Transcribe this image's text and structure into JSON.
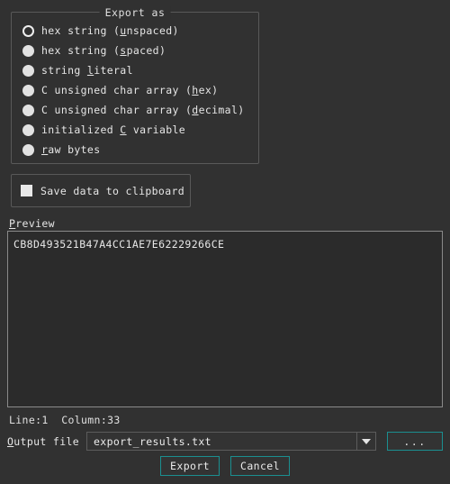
{
  "dialog": {
    "background_color": "#313131",
    "accent_color": "#1b8f90",
    "text_color": "#e8e8e8"
  },
  "export_as": {
    "title": "Export as",
    "options": [
      {
        "pre": "hex string (",
        "mnemonic": "u",
        "post": "nspaced)",
        "selected": true
      },
      {
        "pre": "hex string (",
        "mnemonic": "s",
        "post": "paced)",
        "selected": false
      },
      {
        "pre": "string ",
        "mnemonic": "l",
        "post": "iteral",
        "selected": false
      },
      {
        "pre": "C unsigned char array (",
        "mnemonic": "h",
        "post": "ex)",
        "selected": false
      },
      {
        "pre": "C unsigned char array (",
        "mnemonic": "d",
        "post": "ecimal)",
        "selected": false
      },
      {
        "pre": "initialized ",
        "mnemonic": "C",
        "post": " variable",
        "selected": false
      },
      {
        "pre": "",
        "mnemonic": "r",
        "post": "aw bytes",
        "selected": false
      }
    ]
  },
  "clipboard": {
    "label": "Save data to clipboard",
    "checked": false
  },
  "preview": {
    "label_pre": "",
    "label_mnemonic": "P",
    "label_post": "review",
    "content": "CB8D493521B47A4CC1AE7E62229266CE",
    "status_line": "Line:1",
    "status_column": "Column:33",
    "status_text": "Line:1  Column:33"
  },
  "output": {
    "label_pre": "",
    "label_mnemonic": "O",
    "label_post": "utput file",
    "label_full": "Output file",
    "file_value": "export_results.txt",
    "file_placeholder": "export_results.txt",
    "browse_label": "...",
    "dropdown_icon": "chevron-down-icon"
  },
  "buttons": {
    "export_label": "Export",
    "cancel_label": "Cancel"
  }
}
